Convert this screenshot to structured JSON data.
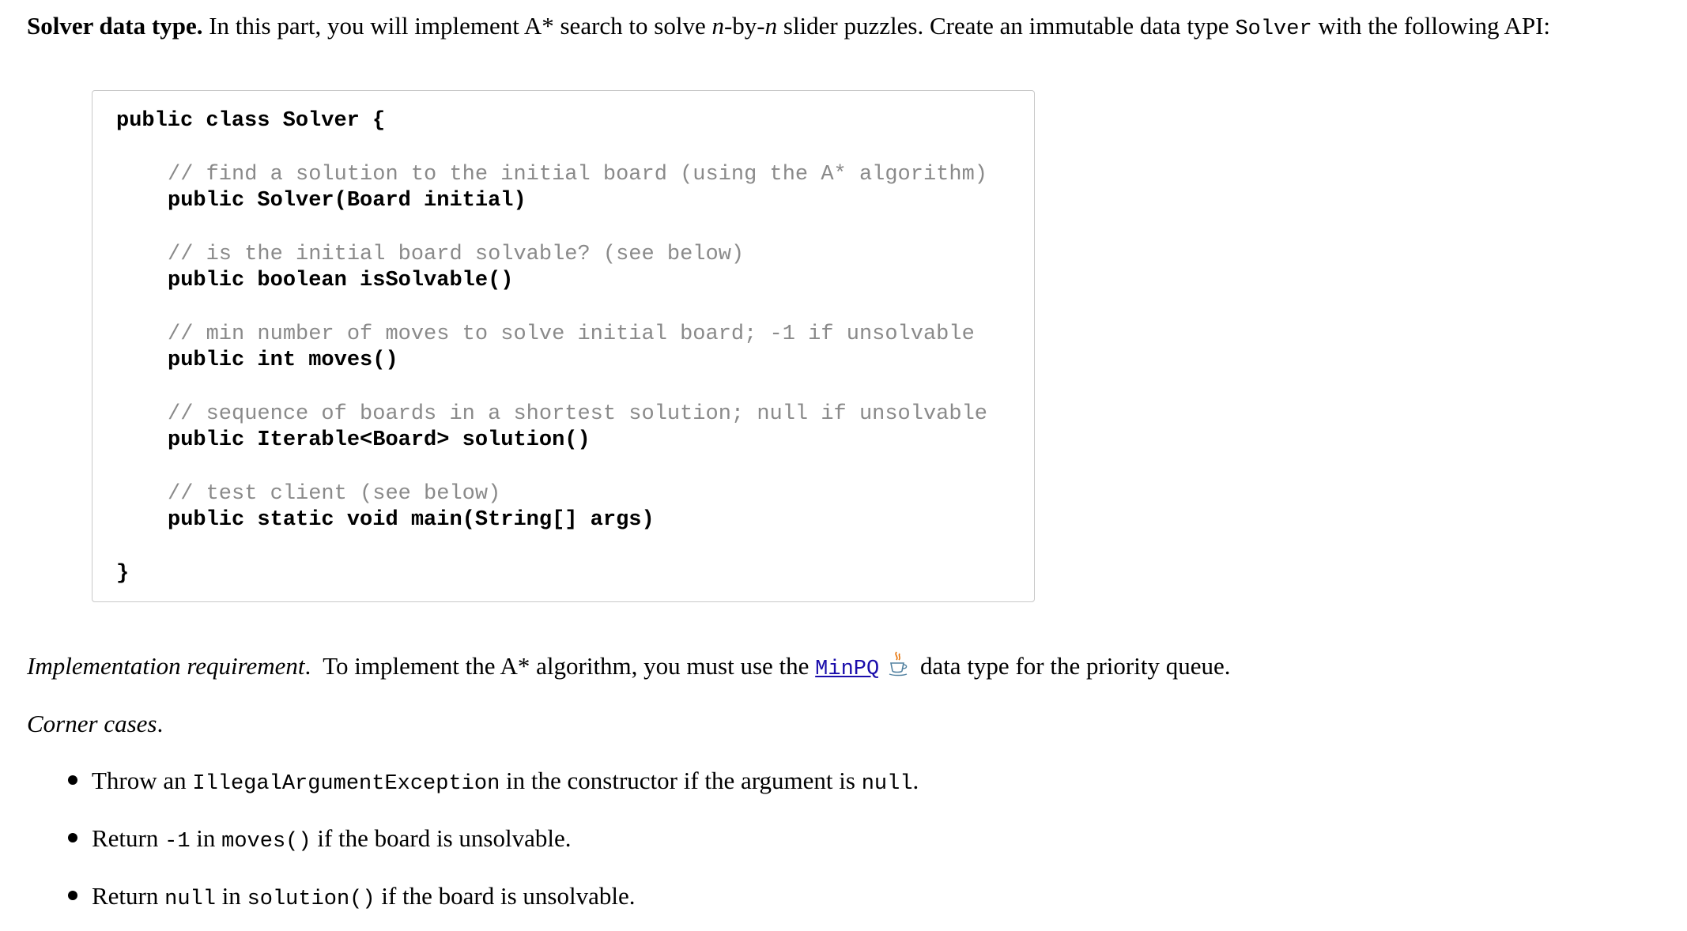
{
  "intro": {
    "heading": "Solver data type.",
    "text_1": " In this part, you will implement A* search to solve ",
    "n1": "n",
    "by": "-by-",
    "n2": "n",
    "text_2": " slider puzzles. Create an immutable data type ",
    "solver_code": "Solver",
    "text_3": " with the following API:"
  },
  "api": {
    "class_open": "public class Solver {",
    "class_close": "}",
    "methods": [
      {
        "comment": "// find a solution to the initial board (using the A* algorithm)",
        "signature": "public Solver(Board initial)"
      },
      {
        "comment": "// is the initial board solvable? (see below)",
        "signature": "public boolean isSolvable()"
      },
      {
        "comment": "// min number of moves to solve initial board; -1 if unsolvable",
        "signature": "public int moves()"
      },
      {
        "comment": "// sequence of boards in a shortest solution; null if unsolvable",
        "signature": "public Iterable<Board> solution()"
      },
      {
        "comment": "// test client (see below)",
        "signature": "public static void main(String[] args)"
      }
    ]
  },
  "implementation": {
    "label": "Implementation requirement",
    "label_period": ".",
    "text_1": "  To implement the A* algorithm, you must use the ",
    "link_text": "MinPQ",
    "icon": "java-cup-icon",
    "text_2": " data type for the priority queue."
  },
  "corner": {
    "label": "Corner cases",
    "label_period": "."
  },
  "bullets": [
    {
      "pre": "Throw an ",
      "code_1": "IllegalArgumentException",
      "mid": " in the constructor if the argument is ",
      "code_2": "null",
      "post": "."
    },
    {
      "pre": "Return ",
      "code_1": "-1",
      "mid": " in ",
      "code_2": "moves()",
      "post": " if the board is unsolvable."
    },
    {
      "pre": "Return ",
      "code_1": "null",
      "mid": " in ",
      "code_2": "solution()",
      "post": " if the board is unsolvable."
    }
  ],
  "colors": {
    "link": "#1a0dab",
    "comment": "#8a8a8a",
    "box_border": "#c8c8c8"
  }
}
